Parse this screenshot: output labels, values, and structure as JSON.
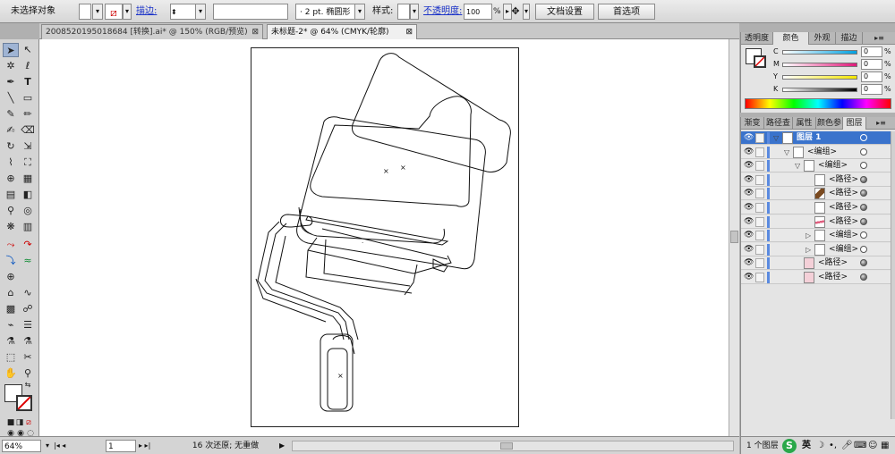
{
  "control_bar": {
    "selection_status": "未选择对象",
    "stroke_label": "描边:",
    "stroke_weight": "2 pt.",
    "brush_name": "椭圆形",
    "style_label": "样式:",
    "opacity_label": "不透明度:",
    "opacity_value": "100",
    "opacity_unit": "%",
    "doc_setup_button": "文档设置",
    "preferences_button": "首选项"
  },
  "document_tabs": [
    {
      "label": "2008520195018684 [转换].ai* @ 150% (RGB/预览)",
      "close": "⊠",
      "active": false
    },
    {
      "label": "未标题-2* @ 64% (CMYK/轮廓)",
      "close": "⊠",
      "active": true
    }
  ],
  "status_bar": {
    "zoom": "64%",
    "artboard_number": "1",
    "history_text": "16 次还原; 无重做"
  },
  "color_panel": {
    "tabs": [
      "透明度",
      "颜色",
      "外观",
      "描边"
    ],
    "active_tab": "颜色",
    "channels": [
      {
        "label": "C",
        "value": "0",
        "unit": "%",
        "color": "#00a0e0"
      },
      {
        "label": "M",
        "value": "0",
        "unit": "%",
        "color": "#e0187a"
      },
      {
        "label": "Y",
        "value": "0",
        "unit": "%",
        "color": "#f4e600"
      },
      {
        "label": "K",
        "value": "0",
        "unit": "%",
        "color": "#000000"
      }
    ]
  },
  "layers_panel": {
    "tabs": [
      "渐变",
      "路径查",
      "属性",
      "颜色参",
      "图层"
    ],
    "active_tab": "图层",
    "rows": [
      {
        "name": "图层 1",
        "indent": 0,
        "expand": "▽",
        "selected": true,
        "thumb": "layer"
      },
      {
        "name": "<编组>",
        "indent": 1,
        "expand": "▽",
        "selected": false,
        "thumb": "group"
      },
      {
        "name": "<编组>",
        "indent": 2,
        "expand": "▽",
        "selected": false,
        "thumb": "group"
      },
      {
        "name": "<路径>",
        "indent": 3,
        "expand": "",
        "selected": false,
        "thumb": "blank"
      },
      {
        "name": "<路径>",
        "indent": 3,
        "expand": "",
        "selected": false,
        "thumb": "brown"
      },
      {
        "name": "<路径>",
        "indent": 3,
        "expand": "",
        "selected": false,
        "thumb": "blank"
      },
      {
        "name": "<路径>",
        "indent": 3,
        "expand": "",
        "selected": false,
        "thumb": "pinkline"
      },
      {
        "name": "<编组>",
        "indent": 3,
        "expand": "▷",
        "selected": false,
        "thumb": "blank"
      },
      {
        "name": "<编组>",
        "indent": 3,
        "expand": "▷",
        "selected": false,
        "thumb": "blank"
      },
      {
        "name": "<路径>",
        "indent": 2,
        "expand": "",
        "selected": false,
        "thumb": "pink"
      },
      {
        "name": "<路径>",
        "indent": 2,
        "expand": "",
        "selected": false,
        "thumb": "pink"
      }
    ],
    "footer": "1 个图层"
  },
  "taskbar": {
    "ime_label": "英"
  },
  "tools": [
    "selection-tool",
    "direct-selection-tool",
    "magic-wand-tool",
    "lasso-tool",
    "pen-tool",
    "type-tool",
    "line-tool",
    "rectangle-tool",
    "paintbrush-tool",
    "pencil-tool",
    "blob-brush-tool",
    "eraser-tool",
    "rotate-tool",
    "scale-tool",
    "warp-tool",
    "free-transform-tool",
    "symbol-sprayer-tool",
    "column-graph-tool",
    "mesh-tool",
    "gradient-tool",
    "eyedropper-tool",
    "blend-tool",
    "live-paint-bucket-tool",
    "live-paint-selection-tool",
    "slice-tool",
    "scissors-tool",
    "hand-tool",
    "zoom-tool"
  ]
}
